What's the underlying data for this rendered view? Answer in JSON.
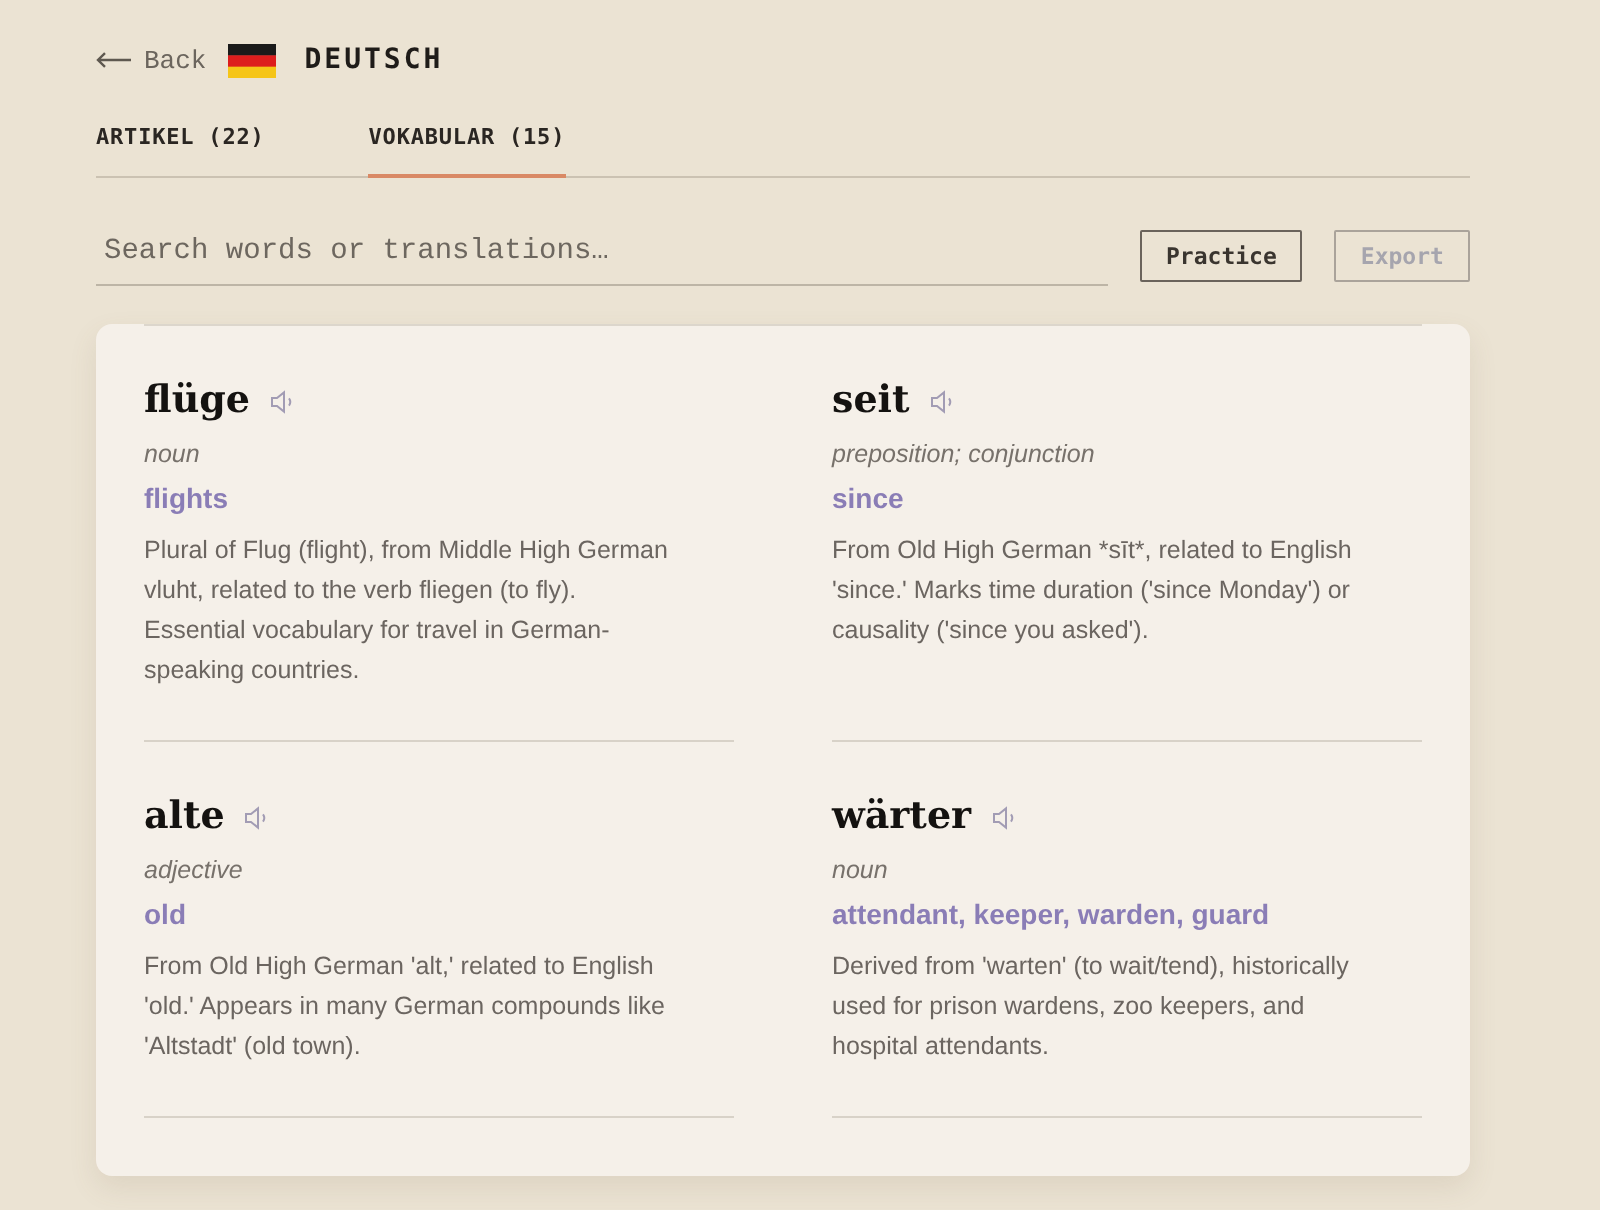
{
  "header": {
    "back": {
      "label": "Back"
    },
    "language": {
      "title": "DEUTSCH"
    }
  },
  "tabs": [
    {
      "label": "ARTIKEL (22)",
      "selected": false
    },
    {
      "label": "VOKABULAR (15)",
      "selected": true
    }
  ],
  "search": {
    "placeholder": "Search words or translations…"
  },
  "buttons": [
    {
      "label": "Practice",
      "disabled": false
    },
    {
      "label": "Export",
      "disabled": true
    }
  ],
  "entries": [
    {
      "word": "flüge",
      "part_of_speech": "noun",
      "translation": "flights",
      "description": "Plural of Flug (flight), from Middle High German vluht, related to the verb fliegen (to fly). Essential vocabulary for travel in German-speaking countries."
    },
    {
      "word": "seit",
      "part_of_speech": "preposition; conjunction",
      "translation": "since",
      "description": "From Old High German *sīt*, related to English 'since.' Marks time duration ('since Monday') or causality ('since you asked')."
    },
    {
      "word": "alte",
      "part_of_speech": "adjective",
      "translation": "old",
      "description": "From Old High German 'alt,' related to English 'old.' Appears in many German compounds like 'Altstadt' (old town)."
    },
    {
      "word": "wärter",
      "part_of_speech": "noun",
      "translation": "attendant, keeper, warden, guard",
      "description": "Derived from 'warten' (to wait/tend), historically used for prison wardens, zoo keepers, and hospital attendants."
    }
  ]
}
